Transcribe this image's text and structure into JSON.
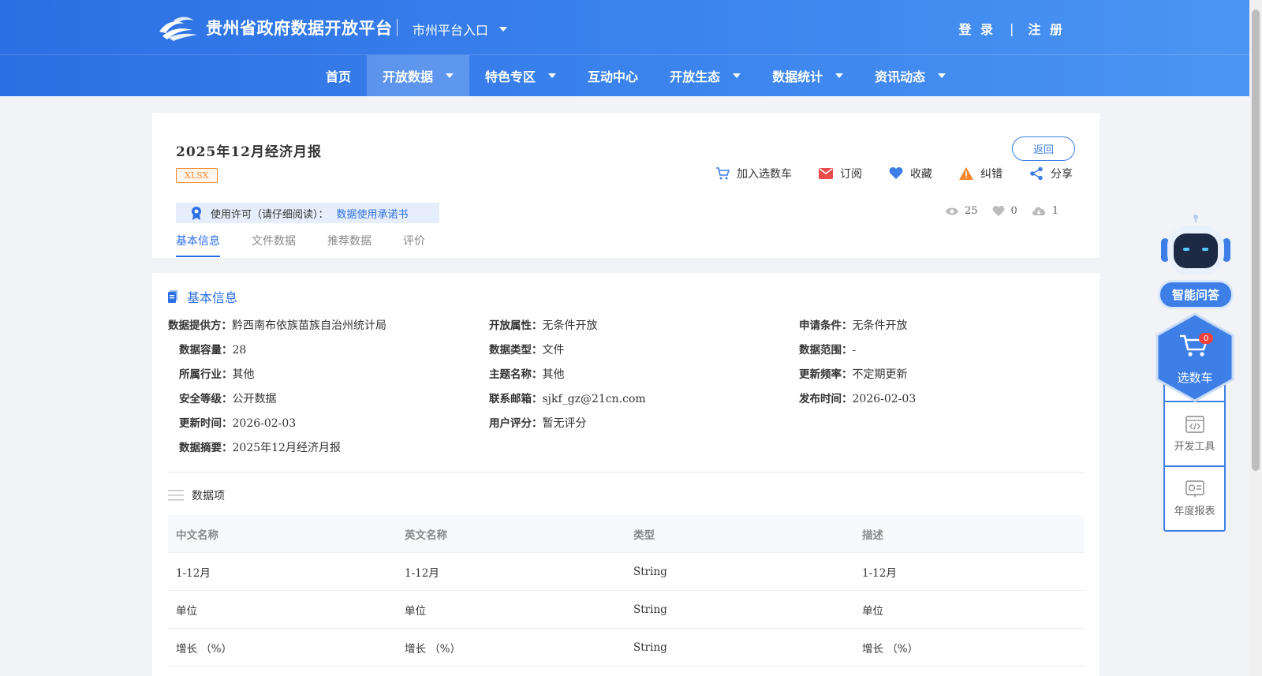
{
  "header": {
    "site_title": "贵州省政府数据开放平台",
    "city_entry": "市州平台入口",
    "login": "登 录",
    "divider": "|",
    "register": "注 册"
  },
  "nav": {
    "items": [
      {
        "label": "首页",
        "has_dropdown": false,
        "active": false
      },
      {
        "label": "开放数据",
        "has_dropdown": true,
        "active": true
      },
      {
        "label": "特色专区",
        "has_dropdown": true,
        "active": false
      },
      {
        "label": "互动中心",
        "has_dropdown": false,
        "active": false
      },
      {
        "label": "开放生态",
        "has_dropdown": true,
        "active": false
      },
      {
        "label": "数据统计",
        "has_dropdown": true,
        "active": false
      },
      {
        "label": "资讯动态",
        "has_dropdown": true,
        "active": false
      }
    ]
  },
  "dataset": {
    "title": "2025年12月经济月报",
    "format_tag": "XLSX",
    "back_label": "返回",
    "actions": {
      "cart": "加入选数车",
      "subscribe": "订阅",
      "favorite": "收藏",
      "report": "纠错",
      "share": "分享"
    },
    "license_label": "使用许可（请仔细阅读）：",
    "license_link": "数据使用承诺书",
    "stats": {
      "views": "25",
      "likes": "0",
      "downloads": "1"
    },
    "tabs": [
      "基本信息",
      "文件数据",
      "推荐数据",
      "评价"
    ]
  },
  "basic_info": {
    "heading": "基本信息",
    "fields": {
      "provider": {
        "k": "数据提供方：",
        "v": "黔西南布依族苗族自治州统计局"
      },
      "open_attr": {
        "k": "开放属性：",
        "v": "无条件开放"
      },
      "apply_cond": {
        "k": "申请条件：",
        "v": "无条件开放"
      },
      "capacity": {
        "k": "数据容量：",
        "v": "28"
      },
      "data_type": {
        "k": "数据类型：",
        "v": "文件"
      },
      "scope": {
        "k": "数据范围：",
        "v": "-"
      },
      "industry": {
        "k": "所属行业：",
        "v": "其他"
      },
      "theme": {
        "k": "主题名称：",
        "v": "其他"
      },
      "frequency": {
        "k": "更新频率：",
        "v": "不定期更新"
      },
      "security": {
        "k": "安全等级：",
        "v": "公开数据"
      },
      "email": {
        "k": "联系邮箱：",
        "v": "sjkf_gz@21cn.com"
      },
      "publish_time": {
        "k": "发布时间：",
        "v": "2026-02-03"
      },
      "update_time": {
        "k": "更新时间：",
        "v": "2026-02-03"
      },
      "rating": {
        "k": "用户评分：",
        "v": "暂无评分"
      },
      "summary": {
        "k": "数据摘要：",
        "v": "2025年12月经济月报"
      }
    }
  },
  "data_items": {
    "heading": "数据项",
    "columns": [
      "中文名称",
      "英文名称",
      "类型",
      "描述"
    ],
    "rows": [
      [
        "1-12月",
        "1-12月",
        "String",
        "1-12月"
      ],
      [
        "单位",
        "单位",
        "String",
        "单位"
      ],
      [
        "增长 （%）",
        "增长 （%）",
        "String",
        "增长 （%）"
      ]
    ]
  },
  "float_panel": {
    "ask": "智能问答",
    "cart": "选数车",
    "cart_count": "0",
    "dev_tools": "开发工具",
    "annual_report": "年度报表"
  },
  "colors": {
    "primary": "#2c6fe4",
    "accent_orange": "#f5862b",
    "danger": "#f0433c"
  }
}
